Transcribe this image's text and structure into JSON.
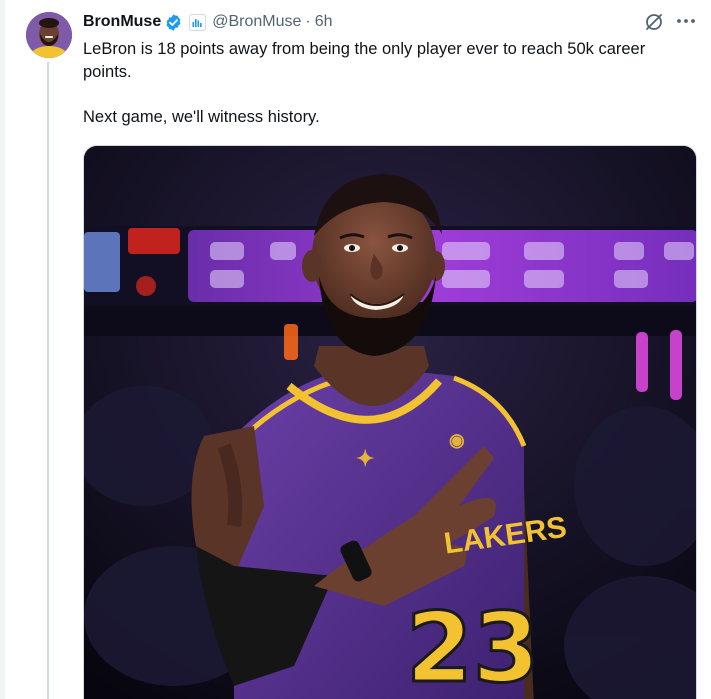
{
  "author": {
    "display_name": "BronMuse",
    "handle": "@BronMuse",
    "separator": "·",
    "time": "6h",
    "verified": true
  },
  "tweet": {
    "line1": "LeBron is 18 points away from being the only player ever to reach 50k career points.",
    "line2": "Next game, we'll witness history."
  },
  "media": {
    "jersey_number": "23",
    "jersey_text": "LAKERS",
    "colors": {
      "jersey_purple": "#55318a",
      "jersey_gold": "#f2c230",
      "arena_purple": "#9f3ad8",
      "skin": "#6b4030"
    }
  },
  "icons": {
    "verified": "verified-check-icon",
    "affiliate": "affiliate-badge-icon",
    "grok": "grok-icon",
    "more": "more-icon"
  },
  "colors": {
    "verified_blue": "#1d9bf0",
    "text_primary": "#0f1419",
    "text_secondary": "#536471",
    "divider": "#cfd9de"
  }
}
